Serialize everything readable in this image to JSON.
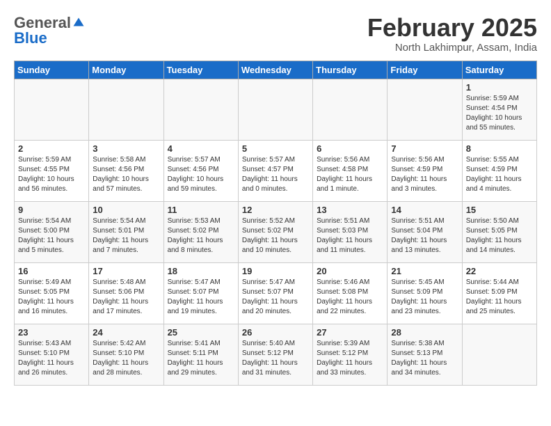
{
  "logo": {
    "general": "General",
    "blue": "Blue"
  },
  "header": {
    "title": "February 2025",
    "subtitle": "North Lakhimpur, Assam, India"
  },
  "weekdays": [
    "Sunday",
    "Monday",
    "Tuesday",
    "Wednesday",
    "Thursday",
    "Friday",
    "Saturday"
  ],
  "weeks": [
    [
      {
        "day": "",
        "info": ""
      },
      {
        "day": "",
        "info": ""
      },
      {
        "day": "",
        "info": ""
      },
      {
        "day": "",
        "info": ""
      },
      {
        "day": "",
        "info": ""
      },
      {
        "day": "",
        "info": ""
      },
      {
        "day": "1",
        "info": "Sunrise: 5:59 AM\nSunset: 4:54 PM\nDaylight: 10 hours\nand 55 minutes."
      }
    ],
    [
      {
        "day": "2",
        "info": "Sunrise: 5:59 AM\nSunset: 4:55 PM\nDaylight: 10 hours\nand 56 minutes."
      },
      {
        "day": "3",
        "info": "Sunrise: 5:58 AM\nSunset: 4:56 PM\nDaylight: 10 hours\nand 57 minutes."
      },
      {
        "day": "4",
        "info": "Sunrise: 5:57 AM\nSunset: 4:56 PM\nDaylight: 10 hours\nand 59 minutes."
      },
      {
        "day": "5",
        "info": "Sunrise: 5:57 AM\nSunset: 4:57 PM\nDaylight: 11 hours\nand 0 minutes."
      },
      {
        "day": "6",
        "info": "Sunrise: 5:56 AM\nSunset: 4:58 PM\nDaylight: 11 hours\nand 1 minute."
      },
      {
        "day": "7",
        "info": "Sunrise: 5:56 AM\nSunset: 4:59 PM\nDaylight: 11 hours\nand 3 minutes."
      },
      {
        "day": "8",
        "info": "Sunrise: 5:55 AM\nSunset: 4:59 PM\nDaylight: 11 hours\nand 4 minutes."
      }
    ],
    [
      {
        "day": "9",
        "info": "Sunrise: 5:54 AM\nSunset: 5:00 PM\nDaylight: 11 hours\nand 5 minutes."
      },
      {
        "day": "10",
        "info": "Sunrise: 5:54 AM\nSunset: 5:01 PM\nDaylight: 11 hours\nand 7 minutes."
      },
      {
        "day": "11",
        "info": "Sunrise: 5:53 AM\nSunset: 5:02 PM\nDaylight: 11 hours\nand 8 minutes."
      },
      {
        "day": "12",
        "info": "Sunrise: 5:52 AM\nSunset: 5:02 PM\nDaylight: 11 hours\nand 10 minutes."
      },
      {
        "day": "13",
        "info": "Sunrise: 5:51 AM\nSunset: 5:03 PM\nDaylight: 11 hours\nand 11 minutes."
      },
      {
        "day": "14",
        "info": "Sunrise: 5:51 AM\nSunset: 5:04 PM\nDaylight: 11 hours\nand 13 minutes."
      },
      {
        "day": "15",
        "info": "Sunrise: 5:50 AM\nSunset: 5:05 PM\nDaylight: 11 hours\nand 14 minutes."
      }
    ],
    [
      {
        "day": "16",
        "info": "Sunrise: 5:49 AM\nSunset: 5:05 PM\nDaylight: 11 hours\nand 16 minutes."
      },
      {
        "day": "17",
        "info": "Sunrise: 5:48 AM\nSunset: 5:06 PM\nDaylight: 11 hours\nand 17 minutes."
      },
      {
        "day": "18",
        "info": "Sunrise: 5:47 AM\nSunset: 5:07 PM\nDaylight: 11 hours\nand 19 minutes."
      },
      {
        "day": "19",
        "info": "Sunrise: 5:47 AM\nSunset: 5:07 PM\nDaylight: 11 hours\nand 20 minutes."
      },
      {
        "day": "20",
        "info": "Sunrise: 5:46 AM\nSunset: 5:08 PM\nDaylight: 11 hours\nand 22 minutes."
      },
      {
        "day": "21",
        "info": "Sunrise: 5:45 AM\nSunset: 5:09 PM\nDaylight: 11 hours\nand 23 minutes."
      },
      {
        "day": "22",
        "info": "Sunrise: 5:44 AM\nSunset: 5:09 PM\nDaylight: 11 hours\nand 25 minutes."
      }
    ],
    [
      {
        "day": "23",
        "info": "Sunrise: 5:43 AM\nSunset: 5:10 PM\nDaylight: 11 hours\nand 26 minutes."
      },
      {
        "day": "24",
        "info": "Sunrise: 5:42 AM\nSunset: 5:10 PM\nDaylight: 11 hours\nand 28 minutes."
      },
      {
        "day": "25",
        "info": "Sunrise: 5:41 AM\nSunset: 5:11 PM\nDaylight: 11 hours\nand 29 minutes."
      },
      {
        "day": "26",
        "info": "Sunrise: 5:40 AM\nSunset: 5:12 PM\nDaylight: 11 hours\nand 31 minutes."
      },
      {
        "day": "27",
        "info": "Sunrise: 5:39 AM\nSunset: 5:12 PM\nDaylight: 11 hours\nand 33 minutes."
      },
      {
        "day": "28",
        "info": "Sunrise: 5:38 AM\nSunset: 5:13 PM\nDaylight: 11 hours\nand 34 minutes."
      },
      {
        "day": "",
        "info": ""
      }
    ]
  ]
}
